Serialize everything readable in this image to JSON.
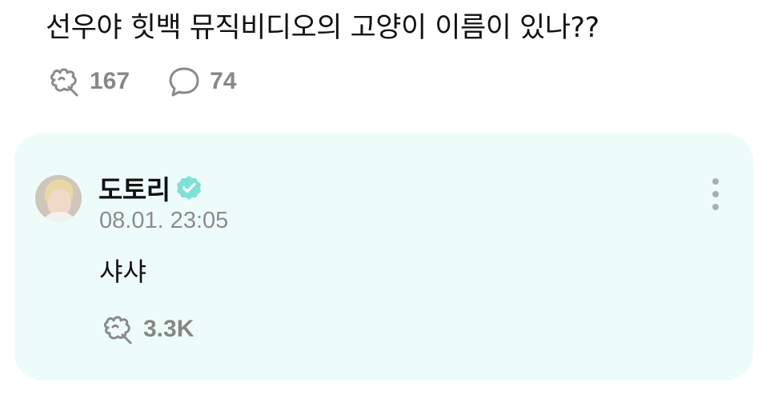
{
  "post": {
    "text": "선우야 힛백 뮤직비디오의 고양이 이름이 있나??",
    "likes": "167",
    "comments": "74"
  },
  "comment": {
    "author": "도토리",
    "verified": true,
    "timestamp": "08.01. 23:05",
    "text": "샤샤",
    "likes": "3.3K"
  },
  "icons": {
    "like": "paw-like-icon",
    "comment": "speech-bubble-icon",
    "verified": "verified-badge-icon",
    "more": "more-vertical-icon"
  },
  "colors": {
    "card_background": "#eefcf9",
    "verified_badge": "#7fe0d6",
    "muted_text": "#878787"
  }
}
